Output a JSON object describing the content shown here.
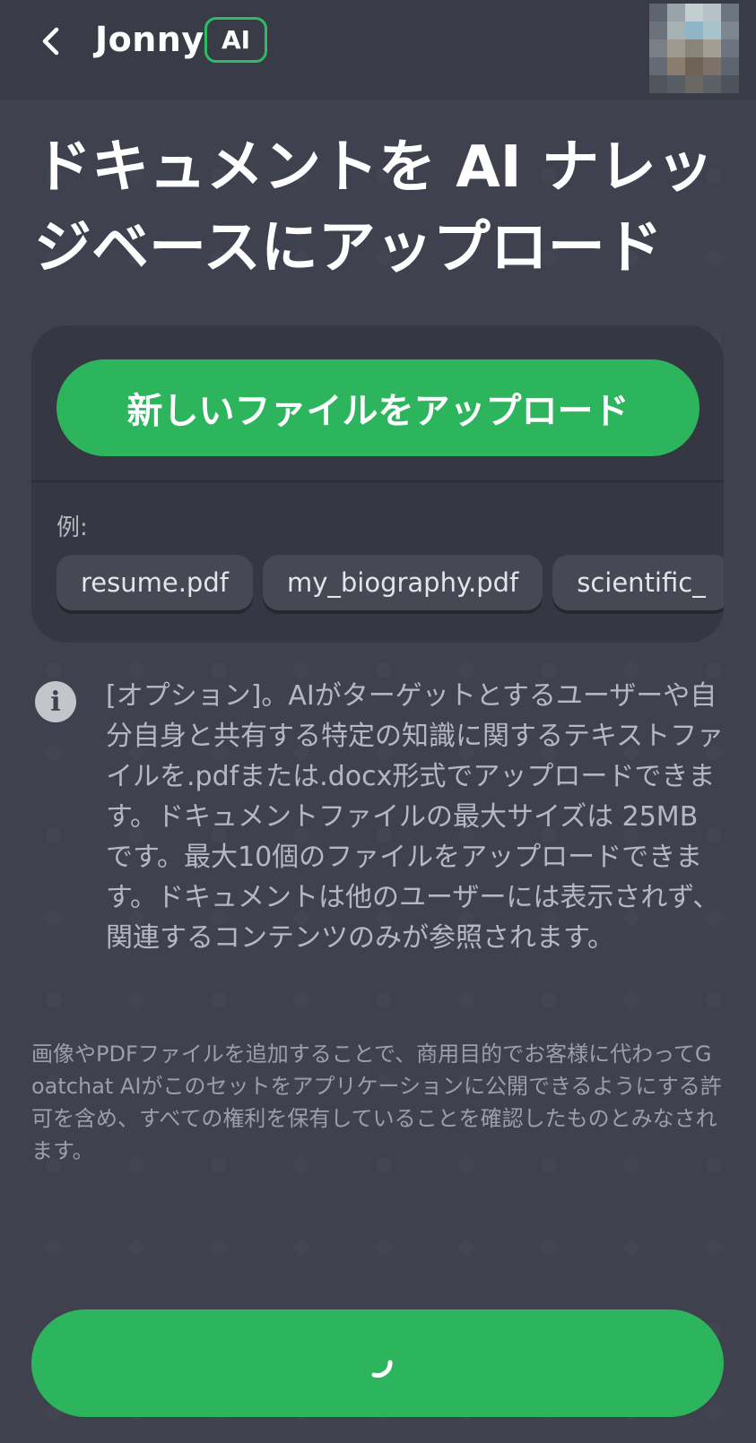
{
  "header": {
    "back_icon": "chevron-left-icon",
    "app_name": "Jonny",
    "badge": "AI",
    "avatar_icon": "user-avatar-pixelated"
  },
  "page": {
    "title": "ドキュメントを AI ナレッ\nジベースにアップロード"
  },
  "upload_card": {
    "upload_button_label": "新しいファイルをアップロード",
    "examples_label": "例:",
    "examples": [
      "resume.pdf",
      "my_biography.pdf",
      "scientific_"
    ]
  },
  "info": {
    "icon": "info-circle-icon",
    "text": "[オプション]。AIがターゲットとするユーザーや自分自身と共有する特定の知識に関するテキストファイルを.pdfまたは.docx形式でアップロードできます。ドキュメントファイルの最大サイズは 25MB です。最大10個のファイルをアップロードできます。ドキュメントは他のユーザーには表示されず、関連するコンテンツのみが参照されます。"
  },
  "disclaimer": "画像やPDFファイルを追加することで、商用目的でお客様に代わってGoatchat AIがこのセットをアプリケーションに公開できるようにする許可を含め、すべての権利を保有していることを確認したものとみなされます。",
  "submit": {
    "state": "loading",
    "icon": "loading-spinner-icon"
  },
  "colors": {
    "background": "#3f414e",
    "header": "#393b46",
    "card": "#353742",
    "accent_green": "#2db55d",
    "chip": "#464854",
    "muted_text": "#b6b8c1"
  }
}
